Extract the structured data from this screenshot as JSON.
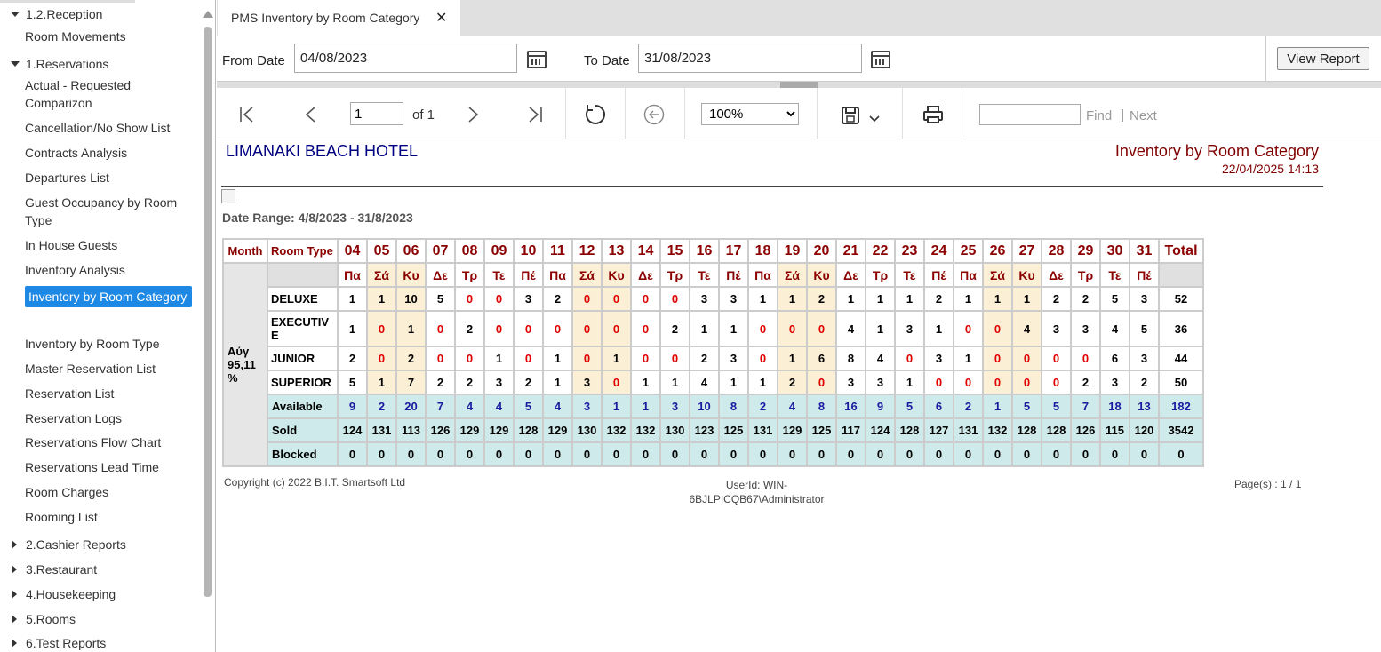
{
  "sidebar": {
    "items": [
      {
        "label": "1.2.Reception",
        "type": "group-open"
      },
      {
        "label": "Room Movements",
        "type": "item"
      },
      {
        "label": "1.Reservations",
        "type": "group-open"
      },
      {
        "label": "Actual - Requested Comparizon",
        "type": "item"
      },
      {
        "label": "Cancellation/No Show List",
        "type": "item"
      },
      {
        "label": "Contracts Analysis",
        "type": "item"
      },
      {
        "label": "Departures List",
        "type": "item"
      },
      {
        "label": "Guest Occupancy by Room Type",
        "type": "item"
      },
      {
        "label": "In House Guests",
        "type": "item"
      },
      {
        "label": "Inventory Analysis",
        "type": "item"
      },
      {
        "label": "Inventory by Room Category",
        "type": "item-selected"
      },
      {
        "label": "Inventory by Room Type",
        "type": "item"
      },
      {
        "label": "Master Reservation List",
        "type": "item"
      },
      {
        "label": "Reservation List",
        "type": "item"
      },
      {
        "label": "Reservation Logs",
        "type": "item"
      },
      {
        "label": "Reservations Flow Chart",
        "type": "item"
      },
      {
        "label": "Reservations Lead Time",
        "type": "item"
      },
      {
        "label": "Room Charges",
        "type": "item"
      },
      {
        "label": "Rooming List",
        "type": "item"
      },
      {
        "label": "2.Cashier Reports",
        "type": "group-closed"
      },
      {
        "label": "3.Restaurant",
        "type": "group-closed"
      },
      {
        "label": "4.Housekeeping",
        "type": "group-closed"
      },
      {
        "label": "5.Rooms",
        "type": "group-closed"
      },
      {
        "label": "6.Test Reports",
        "type": "group-closed"
      }
    ]
  },
  "tab": {
    "title": "PMS Inventory by Room Category",
    "close": "✕"
  },
  "params": {
    "from_label": "From Date",
    "from_value": "04/08/2023",
    "to_label": "To Date",
    "to_value": "31/08/2023",
    "view_button": "View Report"
  },
  "toolbar": {
    "page_value": "1",
    "page_of": "of 1",
    "zoom": "100%",
    "find_label": "Find",
    "next_label": "Next",
    "divider": "|"
  },
  "report": {
    "hotel": "LIMANAKI BEACH HOTEL",
    "title": "Inventory by Room Category",
    "printed": "22/04/2025 14:13",
    "date_range": "Date Range: 4/8/2023 - 31/8/2023",
    "col_month": "Month",
    "col_room_type": "Room Type",
    "col_total": "Total",
    "month_label": "Aύγ 95,11 %",
    "days": [
      "04",
      "05",
      "06",
      "07",
      "08",
      "09",
      "10",
      "11",
      "12",
      "13",
      "14",
      "15",
      "16",
      "17",
      "18",
      "19",
      "20",
      "21",
      "22",
      "23",
      "24",
      "25",
      "26",
      "27",
      "28",
      "29",
      "30",
      "31"
    ],
    "dow": [
      "Πα",
      "Σά",
      "Κυ",
      "Δε",
      "Τρ",
      "Τε",
      "Πέ",
      "Πα",
      "Σά",
      "Κυ",
      "Δε",
      "Τρ",
      "Τε",
      "Πέ",
      "Πα",
      "Σά",
      "Κυ",
      "Δε",
      "Τρ",
      "Τε",
      "Πέ",
      "Πα",
      "Σά",
      "Κυ",
      "Δε",
      "Τρ",
      "Τε",
      "Πέ"
    ],
    "rows": [
      {
        "name": "DELUXE",
        "values": [
          "1",
          "1",
          "10",
          "5",
          "0",
          "0",
          "3",
          "2",
          "0",
          "0",
          "0",
          "0",
          "3",
          "3",
          "1",
          "1",
          "2",
          "1",
          "1",
          "1",
          "2",
          "1",
          "1",
          "1",
          "2",
          "2",
          "5",
          "3"
        ],
        "total": "52"
      },
      {
        "name": "EXECUTIVE",
        "values": [
          "1",
          "0",
          "1",
          "0",
          "2",
          "0",
          "0",
          "0",
          "0",
          "0",
          "0",
          "2",
          "1",
          "1",
          "0",
          "0",
          "0",
          "4",
          "1",
          "3",
          "1",
          "0",
          "0",
          "4",
          "3",
          "3",
          "4",
          "5"
        ],
        "total": "36"
      },
      {
        "name": "JUNIOR",
        "values": [
          "2",
          "0",
          "2",
          "0",
          "0",
          "1",
          "0",
          "1",
          "0",
          "1",
          "0",
          "0",
          "2",
          "3",
          "0",
          "1",
          "6",
          "8",
          "4",
          "0",
          "3",
          "1",
          "0",
          "0",
          "0",
          "0",
          "6",
          "3"
        ],
        "total": "44"
      },
      {
        "name": "SUPERIOR",
        "values": [
          "5",
          "1",
          "7",
          "2",
          "2",
          "3",
          "2",
          "1",
          "3",
          "0",
          "1",
          "1",
          "4",
          "1",
          "1",
          "2",
          "0",
          "3",
          "3",
          "1",
          "0",
          "0",
          "0",
          "0",
          "0",
          "2",
          "3",
          "2"
        ],
        "total": "50"
      }
    ],
    "available": {
      "label": "Available",
      "values": [
        "9",
        "2",
        "20",
        "7",
        "4",
        "4",
        "5",
        "4",
        "3",
        "1",
        "1",
        "3",
        "10",
        "8",
        "2",
        "4",
        "8",
        "16",
        "9",
        "5",
        "6",
        "2",
        "1",
        "5",
        "5",
        "7",
        "18",
        "13"
      ],
      "total": "182"
    },
    "sold": {
      "label": "Sold",
      "values": [
        "124",
        "131",
        "113",
        "126",
        "129",
        "129",
        "128",
        "129",
        "130",
        "132",
        "132",
        "130",
        "123",
        "125",
        "131",
        "129",
        "125",
        "117",
        "124",
        "128",
        "127",
        "131",
        "132",
        "128",
        "128",
        "126",
        "115",
        "120"
      ],
      "total": "3542"
    },
    "blocked": {
      "label": "Blocked",
      "values": [
        "0",
        "0",
        "0",
        "0",
        "0",
        "0",
        "0",
        "0",
        "0",
        "0",
        "0",
        "0",
        "0",
        "0",
        "0",
        "0",
        "0",
        "0",
        "0",
        "0",
        "0",
        "0",
        "0",
        "0",
        "0",
        "0",
        "0",
        "0"
      ],
      "total": "0"
    },
    "copyright": "Copyright (c) 2022 B.I.T. Smartsoft Ltd",
    "userid": "UserId: WIN-6BJLPICQB67\\Administrator",
    "pages": "Page(s) : 1  / 1"
  },
  "colors": {
    "accent": "#1e88e5",
    "header_red": "#8b0000",
    "hotel_blue": "#000080",
    "weekend": "#fbefd5",
    "totals_bg": "#cfeaea"
  }
}
